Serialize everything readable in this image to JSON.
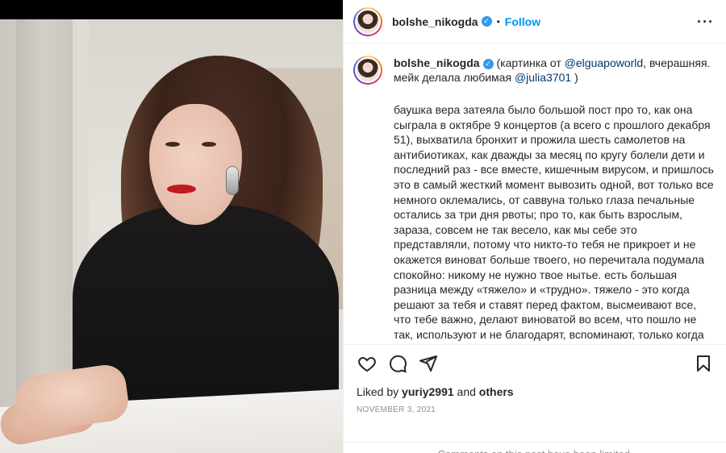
{
  "post": {
    "username": "bolshe_nikogda",
    "verified_icon": "verified-badge-icon",
    "dot": "•",
    "follow_label": "Follow",
    "more_label": "···"
  },
  "caption": {
    "username": "bolshe_nikogda",
    "text_before": "(картинка от ",
    "mention1": "@elguapoworld",
    "text_middle": ", вчерашняя. мейк делала любимая ",
    "mention2": "@julia3701",
    "text_after": " )",
    "body": "баушка вера затеяла было большой пост про то, как она сыграла в октябре 9 концертов (а всего с прошлого декабря 51), выхватила бронхит и прожила шесть самолетов на антибиотиках, как дважды за месяц по кругу болели дети и последний раз - все вместе, кишечным вирусом, и пришлось это в самый жесткий момент вывозить одной, вот только все немного оклемались, от саввуна только глаза печальные остались за три дня рвоты; про то, как быть взрослым, зараза, совсем не так весело, как мы себе это представляли, потому что никто-то тебя не прикроет и не окажется виноват больше твоего, но перечитала подумала спокойно: никому не нужно твое нытье. есть большая разница между «тяжело» и «трудно». тяжело - это когда решают за тебя и ставят перед фактом, высмеивают все, что тебе важно, делают виноватой во всем, что пошло не так, используют и не благодарят, вспоминают, только когда нужно самоутвердиться и потешить тщеславие, замечают, только если все классно, а"
  },
  "actions": {
    "like_icon": "heart-icon",
    "comment_icon": "comment-icon",
    "share_icon": "paper-plane-icon",
    "save_icon": "bookmark-icon"
  },
  "likes": {
    "prefix": "Liked by",
    "user": "yuriy2991",
    "and": "and",
    "others": "others"
  },
  "date": "NOVEMBER 3, 2021",
  "comments_limited": "Comments on this post have been limited."
}
